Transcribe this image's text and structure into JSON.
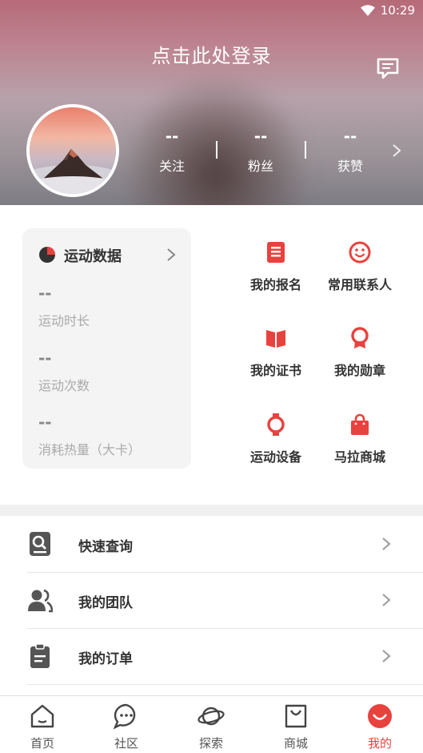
{
  "status_bar": {
    "time": "10:29"
  },
  "header": {
    "login_prompt": "点击此处登录",
    "stats": [
      {
        "value": "--",
        "label": "关注"
      },
      {
        "value": "--",
        "label": "粉丝"
      },
      {
        "value": "--",
        "label": "获赞"
      }
    ]
  },
  "sport_card": {
    "title": "运动数据",
    "metrics": [
      {
        "value": "--",
        "label": "运动时长"
      },
      {
        "value": "--",
        "label": "运动次数"
      },
      {
        "value": "--",
        "label": "消耗热量（大卡）"
      }
    ]
  },
  "quick_grid": {
    "items": [
      {
        "label": "我的报名",
        "icon": "signup-list-icon"
      },
      {
        "label": "常用联系人",
        "icon": "smile-contact-icon"
      },
      {
        "label": "我的证书",
        "icon": "certificate-book-icon"
      },
      {
        "label": "我的勋章",
        "icon": "medal-icon"
      },
      {
        "label": "运动设备",
        "icon": "smartwatch-icon"
      },
      {
        "label": "马拉商城",
        "icon": "shopping-bag-icon"
      }
    ]
  },
  "menu_list": {
    "items": [
      {
        "label": "快速查询",
        "icon": "quick-search-icon"
      },
      {
        "label": "我的团队",
        "icon": "team-icon"
      },
      {
        "label": "我的订单",
        "icon": "order-clipboard-icon"
      }
    ]
  },
  "bottom_nav": {
    "items": [
      {
        "label": "首页",
        "icon": "home-icon"
      },
      {
        "label": "社区",
        "icon": "community-chat-icon"
      },
      {
        "label": "探索",
        "icon": "planet-explore-icon"
      },
      {
        "label": "商城",
        "icon": "mall-bag-icon"
      },
      {
        "label": "我的",
        "icon": "profile-smile-icon",
        "active": true
      }
    ]
  },
  "colors": {
    "accent": "#e8423e",
    "header_top": "#b66a78",
    "header_bottom": "#7e7d84",
    "card_bg": "#f4f4f4"
  }
}
